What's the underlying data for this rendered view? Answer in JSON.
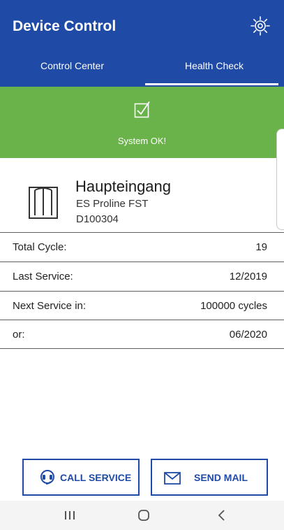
{
  "app": {
    "title": "Device Control"
  },
  "icons": {
    "settings": "gear-icon",
    "status": "checkbox-checked-icon",
    "device": "revolving-door-icon",
    "call": "headset-icon",
    "mail": "envelope-icon"
  },
  "tabs": [
    {
      "label": "Control Center",
      "active": false
    },
    {
      "label": "Health Check",
      "active": true
    }
  ],
  "status": {
    "text": "System OK!",
    "color": "#6ab24a"
  },
  "device": {
    "name": "Haupteingang",
    "model": "ES Proline FST",
    "serial": "D100304"
  },
  "info_rows": [
    {
      "label": "Total Cycle:",
      "value": "19"
    },
    {
      "label": "Last Service:",
      "value": "12/2019"
    },
    {
      "label": "Next Service in:",
      "value": "100000 cycles"
    },
    {
      "label": "or:",
      "value": "06/2020"
    }
  ],
  "actions": {
    "call_label": "CALL SERVICE",
    "mail_label": "SEND MAIL"
  },
  "colors": {
    "primary": "#1f4aa6",
    "success": "#6ab24a"
  }
}
